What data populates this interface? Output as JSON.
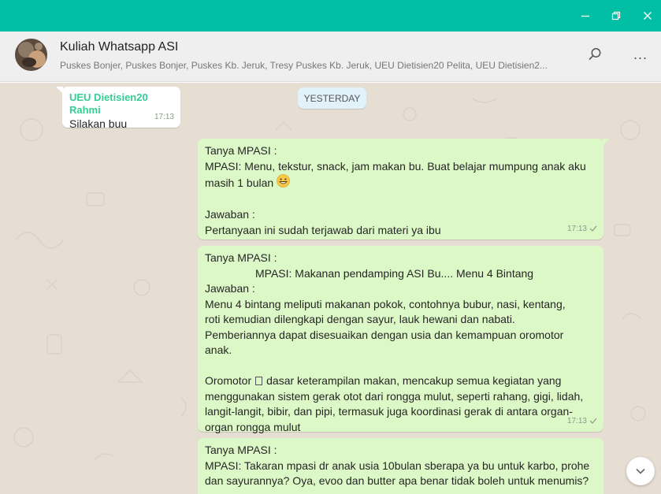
{
  "window": {
    "minimize_icon": "minimize-icon",
    "maximize_icon": "restore-icon",
    "close_icon": "close-icon",
    "accent_color": "#00bfa5"
  },
  "header": {
    "group_name": "Kuliah Whatsapp ASI",
    "members": "Puskes Bonjer, Puskes Bonjer, Puskes Kb. Jeruk, Tresy Puskes Kb. Jeruk, UEU Dietisien20 Pelita, UEU Dietisien2...",
    "search_icon": "search-icon",
    "menu_icon": "more-icon",
    "menu_label": "..."
  },
  "date_divider": "YESTERDAY",
  "messages": [
    {
      "direction": "incoming",
      "sender": "UEU Dietisien20 Rahmi",
      "text": "Silakan buu",
      "time": "17:13"
    },
    {
      "direction": "outgoing",
      "lines": [
        "Tanya MPASI :",
        "MPASI: Menu, tekstur, snack, jam makan bu. Buat belajar mumpung anak aku",
        "masih 1 bulan",
        "",
        "Jawaban :",
        "Pertanyaan ini sudah terjawab dari materi ya ibu"
      ],
      "emoji": "grinning-face",
      "time": "17:13",
      "status": "sent"
    },
    {
      "direction": "outgoing",
      "lines": [
        "Tanya MPASI :",
        "MPASI: Makanan pendamping ASI Bu.... Menu 4 Bintang",
        "Jawaban :",
        "Menu 4 bintang meliputi makanan pokok, contohnya bubur, nasi, kentang,",
        "roti kemudian dilengkapi dengan sayur, lauk hewani dan nabati.",
        "Pemberiannya dapat disesuaikan dengan usia dan kemampuan oromotor",
        "anak.",
        "",
        "Oromotor",
        "menggunakan sistem gerak otot dari rongga mulut, seperti rahang, gigi, lidah,",
        "langit-langit, bibir, dan pipi, termasuk juga koordinasi gerak di antara organ-",
        "organ rongga mulut"
      ],
      "oromotor_rest": "dasar keterampilan makan, mencakup semua kegiatan yang",
      "time": "17:13",
      "status": "sent"
    },
    {
      "direction": "outgoing",
      "lines": [
        "Tanya MPASI :",
        "MPASI: Takaran mpasi dr anak usia 10bulan sberapa ya bu untuk karbo, prohe",
        "dan sayurannya? Oya, evoo dan butter apa benar tidak boleh untuk menumis?"
      ]
    }
  ],
  "scroll_down_icon": "chevron-down-icon",
  "colors": {
    "outgoing_bubble": "#dcf8c6",
    "incoming_bubble": "#ffffff",
    "sender_name": "#35cd96",
    "chat_background": "#e6ddd3",
    "date_pill": "#e1f2fb"
  }
}
